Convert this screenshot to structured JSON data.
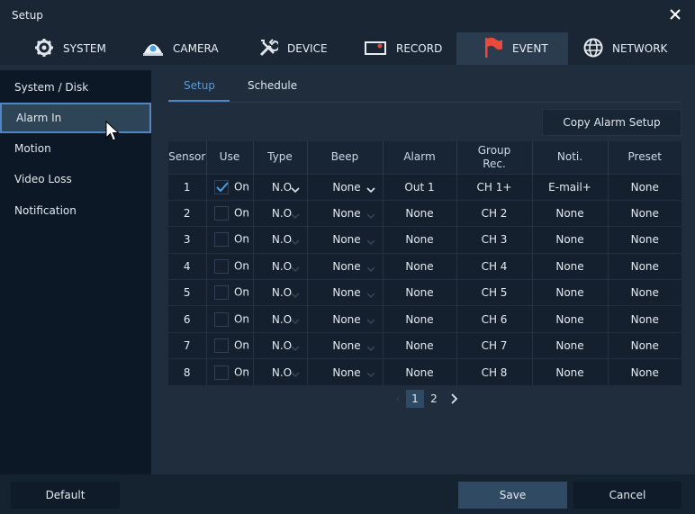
{
  "window": {
    "title": "Setup"
  },
  "tabs": [
    {
      "label": "SYSTEM",
      "icon": "gear-icon"
    },
    {
      "label": "CAMERA",
      "icon": "camera-icon"
    },
    {
      "label": "DEVICE",
      "icon": "tools-icon"
    },
    {
      "label": "RECORD",
      "icon": "record-icon"
    },
    {
      "label": "EVENT",
      "icon": "flag-icon",
      "active": true
    },
    {
      "label": "NETWORK",
      "icon": "globe-icon"
    }
  ],
  "sidebar": {
    "items": [
      {
        "label": "System / Disk"
      },
      {
        "label": "Alarm In",
        "active": true
      },
      {
        "label": "Motion"
      },
      {
        "label": "Video Loss"
      },
      {
        "label": "Notification"
      }
    ]
  },
  "subtabs": [
    {
      "label": "Setup",
      "active": true
    },
    {
      "label": "Schedule"
    }
  ],
  "copy_button": "Copy Alarm Setup",
  "table": {
    "headers": {
      "sensor": "Sensor",
      "use": "Use",
      "type": "Type",
      "beep": "Beep",
      "alarm": "Alarm",
      "group_rec_1": "Group",
      "group_rec_2": "Rec.",
      "noti": "Noti.",
      "preset": "Preset"
    },
    "rows": [
      {
        "sensor": "1",
        "use_checked": true,
        "use_label": "On",
        "type": "N.O",
        "beep": "None",
        "alarm": "Out 1",
        "group_rec": "CH 1+",
        "noti": "E-mail+",
        "preset": "None"
      },
      {
        "sensor": "2",
        "use_checked": false,
        "use_label": "On",
        "type": "N.O",
        "beep": "None",
        "alarm": "None",
        "group_rec": "CH 2",
        "noti": "None",
        "preset": "None"
      },
      {
        "sensor": "3",
        "use_checked": false,
        "use_label": "On",
        "type": "N.O",
        "beep": "None",
        "alarm": "None",
        "group_rec": "CH 3",
        "noti": "None",
        "preset": "None"
      },
      {
        "sensor": "4",
        "use_checked": false,
        "use_label": "On",
        "type": "N.O",
        "beep": "None",
        "alarm": "None",
        "group_rec": "CH 4",
        "noti": "None",
        "preset": "None"
      },
      {
        "sensor": "5",
        "use_checked": false,
        "use_label": "On",
        "type": "N.O",
        "beep": "None",
        "alarm": "None",
        "group_rec": "CH 5",
        "noti": "None",
        "preset": "None"
      },
      {
        "sensor": "6",
        "use_checked": false,
        "use_label": "On",
        "type": "N.O",
        "beep": "None",
        "alarm": "None",
        "group_rec": "CH 6",
        "noti": "None",
        "preset": "None"
      },
      {
        "sensor": "7",
        "use_checked": false,
        "use_label": "On",
        "type": "N.O",
        "beep": "None",
        "alarm": "None",
        "group_rec": "CH 7",
        "noti": "None",
        "preset": "None"
      },
      {
        "sensor": "8",
        "use_checked": false,
        "use_label": "On",
        "type": "N.O",
        "beep": "None",
        "alarm": "None",
        "group_rec": "CH 8",
        "noti": "None",
        "preset": "None"
      }
    ]
  },
  "pagination": {
    "pages": [
      "1",
      "2"
    ],
    "current": "1"
  },
  "footer": {
    "default": "Default",
    "save": "Save",
    "cancel": "Cancel"
  },
  "colors": {
    "accent": "#4d88c4",
    "dim_text": "#3d6a92",
    "sidebar_bg": "#0c1826"
  }
}
